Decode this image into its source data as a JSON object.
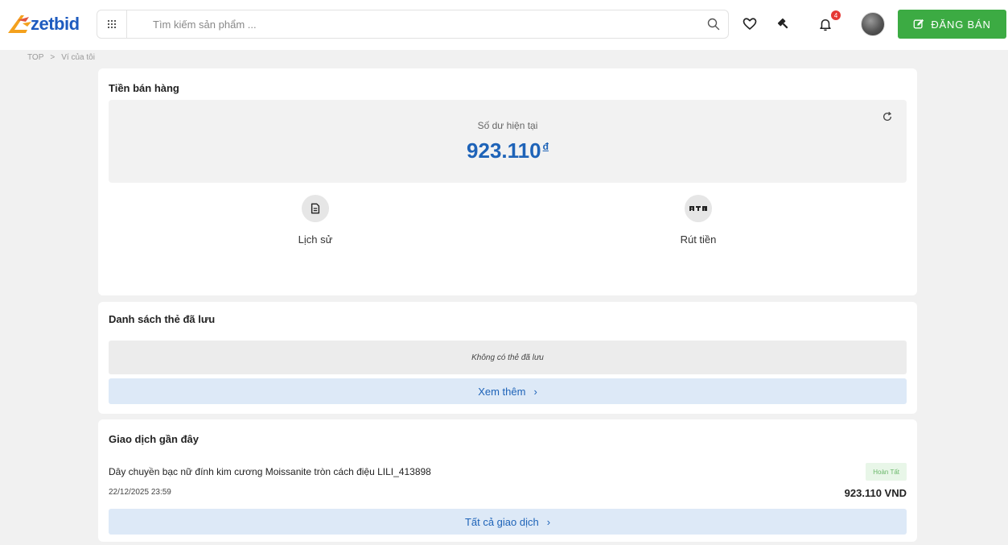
{
  "header": {
    "logo_text": "zetbid",
    "search_placeholder": "Tìm kiếm sản phẩm ...",
    "notification_count": "4",
    "sell_button_label": "ĐĂNG BÁN",
    "brand_color": "#1e5bbf",
    "sell_color": "#3cab43"
  },
  "breadcrumb": {
    "home": "TOP",
    "separator": ">",
    "current": "Ví của tôi"
  },
  "sales_card": {
    "title": "Tiền bán hàng",
    "balance_label": "Số dư hiện tại",
    "balance_value": "923.110",
    "currency_symbol": "đ",
    "actions": [
      {
        "label": "Lịch sử",
        "icon": "document-icon"
      },
      {
        "label": "Rút tiền",
        "icon": "atm-icon"
      }
    ]
  },
  "cards_card": {
    "title": "Danh sách thẻ đã lưu",
    "empty_text": "Không có thẻ đã lưu",
    "more_label": "Xem thêm",
    "more_arrow": "›"
  },
  "transactions_card": {
    "title": "Giao dịch gần đây",
    "items": [
      {
        "name": "Dây chuyền bạc nữ đính kim cương Moissanite tròn cách điệu LILI_413898",
        "date": "22/12/2025 23:59",
        "status": "Hoàn Tất",
        "amount": "923.110 VND"
      }
    ],
    "all_label": "Tất cả giao dịch",
    "all_arrow": "›"
  }
}
